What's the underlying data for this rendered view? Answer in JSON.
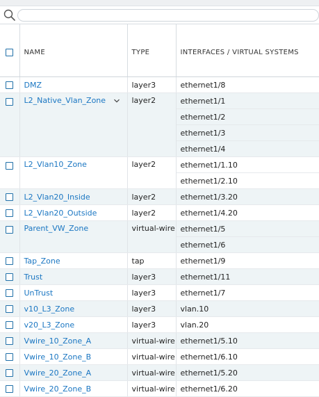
{
  "search": {
    "placeholder": ""
  },
  "columns": {
    "name": "NAME",
    "type": "TYPE",
    "interfaces": "INTERFACES / VIRTUAL SYSTEMS"
  },
  "zones": [
    {
      "name": "DMZ",
      "type": "layer3",
      "interfaces": [
        "ethernet1/8"
      ]
    },
    {
      "name": "L2_Native_Vlan_Zone",
      "type": "layer2",
      "interfaces": [
        "ethernet1/1",
        "ethernet1/2",
        "ethernet1/3",
        "ethernet1/4"
      ],
      "has_dropdown": true
    },
    {
      "name": "L2_Vlan10_Zone",
      "type": "layer2",
      "interfaces": [
        "ethernet1/1.10",
        "ethernet1/2.10"
      ]
    },
    {
      "name": "L2_Vlan20_Inside",
      "type": "layer2",
      "interfaces": [
        "ethernet1/3.20"
      ]
    },
    {
      "name": "L2_Vlan20_Outside",
      "type": "layer2",
      "interfaces": [
        "ethernet1/4.20"
      ]
    },
    {
      "name": "Parent_VW_Zone",
      "type": "virtual-wire",
      "interfaces": [
        "ethernet1/5",
        "ethernet1/6"
      ]
    },
    {
      "name": "Tap_Zone",
      "type": "tap",
      "interfaces": [
        "ethernet1/9"
      ]
    },
    {
      "name": "Trust",
      "type": "layer3",
      "interfaces": [
        "ethernet1/11"
      ]
    },
    {
      "name": "UnTrust",
      "type": "layer3",
      "interfaces": [
        "ethernet1/7"
      ]
    },
    {
      "name": "v10_L3_Zone",
      "type": "layer3",
      "interfaces": [
        "vlan.10"
      ]
    },
    {
      "name": "v20_L3_Zone",
      "type": "layer3",
      "interfaces": [
        "vlan.20"
      ]
    },
    {
      "name": "Vwire_10_Zone_A",
      "type": "virtual-wire",
      "interfaces": [
        "ethernet1/5.10"
      ]
    },
    {
      "name": "Vwire_10_Zone_B",
      "type": "virtual-wire",
      "interfaces": [
        "ethernet1/6.10"
      ]
    },
    {
      "name": "Vwire_20_Zone_A",
      "type": "virtual-wire",
      "interfaces": [
        "ethernet1/5.20"
      ]
    },
    {
      "name": "Vwire_20_Zone_B",
      "type": "virtual-wire",
      "interfaces": [
        "ethernet1/6.20"
      ]
    }
  ]
}
